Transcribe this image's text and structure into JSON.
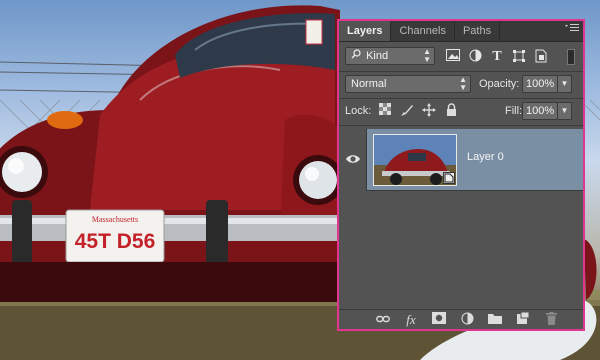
{
  "panel": {
    "tabs": [
      {
        "label": "Layers",
        "active": true
      },
      {
        "label": "Channels",
        "active": false
      },
      {
        "label": "Paths",
        "active": false
      }
    ],
    "menu_icon": "panel-menu-icon",
    "filter": {
      "label": "Kind",
      "icon": "search-icon"
    },
    "filter_icons": [
      "pixel-layer-icon",
      "adjustment-layer-icon",
      "type-layer-icon",
      "shape-layer-icon",
      "smart-object-icon"
    ],
    "blend_mode": "Normal",
    "opacity_label": "Opacity:",
    "opacity_value": "100%",
    "lock_label": "Lock:",
    "lock_icons": [
      "lock-transparent-pixels-icon",
      "lock-image-pixels-icon",
      "lock-position-icon",
      "lock-all-icon"
    ],
    "fill_label": "Fill:",
    "fill_value": "100%",
    "layers": [
      {
        "name": "Layer 0",
        "visible": true,
        "selected": true
      }
    ],
    "footer_icons": [
      "link-layers-icon",
      "fx-icon",
      "add-mask-icon",
      "adjustment-icon",
      "new-group-icon",
      "new-layer-icon",
      "delete-layer-icon"
    ],
    "footer_fx": "fx",
    "accent_color": "#e0368f",
    "selected_layer_color": "#7a8ea4"
  },
  "background": {
    "license_plate_state": "Massachusetts",
    "license_plate_text": "45T D56"
  }
}
